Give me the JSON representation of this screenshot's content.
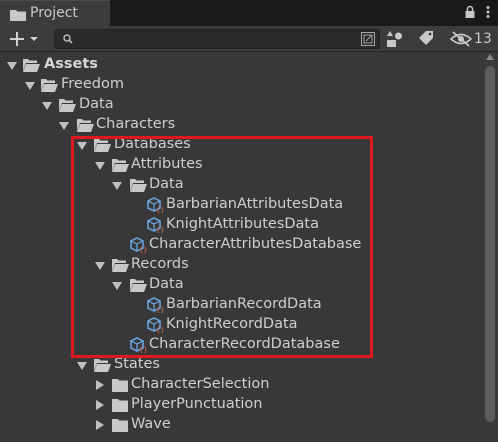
{
  "window": {
    "tab_title": "Project",
    "hidden_count": "13"
  },
  "search": {
    "placeholder": "",
    "value": ""
  },
  "colors": {
    "folder": "#c2c2c2",
    "asset_icon": "#6aa9e8",
    "highlight": "#e0191f"
  },
  "tree": {
    "assets": "Assets",
    "freedom": "Freedom",
    "data": "Data",
    "characters": "Characters",
    "databases": "Databases",
    "attributes": "Attributes",
    "attributes_data": "Data",
    "barbarian_attributes_data": "BarbarianAttributesData",
    "knight_attributes_data": "KnightAttributesData",
    "character_attributes_database": "CharacterAttributesDatabase",
    "records": "Records",
    "records_data": "Data",
    "barbarian_record_data": "BarbarianRecordData",
    "knight_record_data": "KnightRecordData",
    "character_record_database": "CharacterRecordDatabase",
    "states": "States",
    "character_selection": "CharacterSelection",
    "player_punctuation": "PlayerPunctuation",
    "wave": "Wave"
  }
}
